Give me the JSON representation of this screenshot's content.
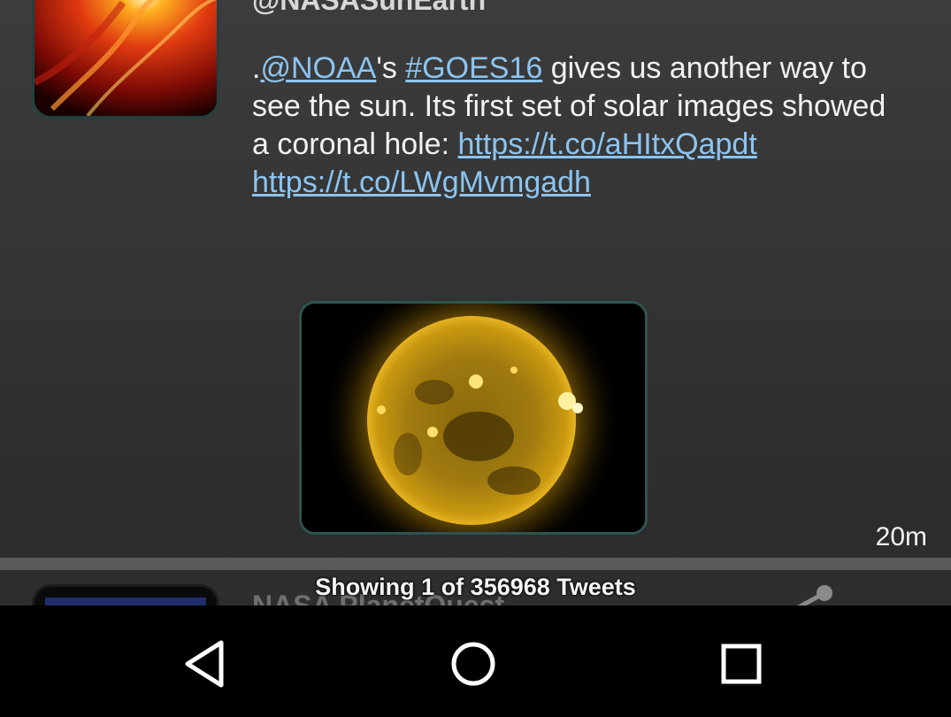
{
  "tweet": {
    "handle": "@NASASunEarth",
    "text_prefix": ".",
    "mention": "@NOAA",
    "mention_suffix": "'s ",
    "hashtag": "#GOES16",
    "body": " gives us another way to see the sun. Its first set of solar images showed a coronal hole: ",
    "link1": "https://t.co/aHItxQapdt",
    "link_separator": " ",
    "link2": "https://t.co/LWgMvmgadh",
    "timestamp": "20m"
  },
  "next_tweet": {
    "handle": "NASA PlanetQuest"
  },
  "status_text": "Showing 1 of 356968 Tweets",
  "colors": {
    "link": "#8cc4f0",
    "sun_core": "#b8860b",
    "navbar": "#000000"
  },
  "icons": {
    "share": "share-icon",
    "back": "back-icon",
    "home": "home-icon",
    "recents": "recents-icon"
  }
}
